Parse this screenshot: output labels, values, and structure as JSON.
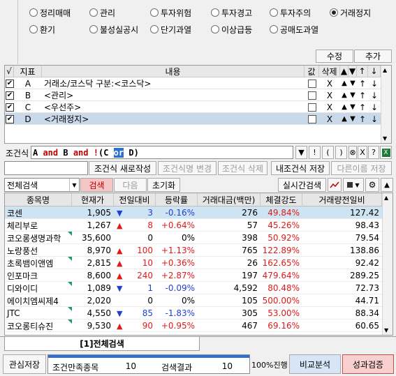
{
  "filters": {
    "row1": [
      {
        "label": "정리매매",
        "selected": false
      },
      {
        "label": "관리",
        "selected": false
      },
      {
        "label": "투자위험",
        "selected": false
      },
      {
        "label": "투자경고",
        "selected": false
      },
      {
        "label": "투자주의",
        "selected": false
      },
      {
        "label": "거래정지",
        "selected": true
      }
    ],
    "row2": [
      {
        "label": "환기",
        "selected": false
      },
      {
        "label": "불성실공시",
        "selected": false
      },
      {
        "label": "단기과열",
        "selected": false
      },
      {
        "label": "이상급등",
        "selected": false
      },
      {
        "label": "공매도과열",
        "selected": false
      }
    ]
  },
  "actions": {
    "modify": "수정",
    "add": "추가"
  },
  "condition_grid": {
    "headers": {
      "check": "√",
      "index": "지표",
      "content": "내용",
      "value": "값",
      "delete": "삭제"
    },
    "rows": [
      {
        "checked": true,
        "index": "A",
        "content": "거래소/코스닥 구분:<코스닥>",
        "delete": "X"
      },
      {
        "checked": true,
        "index": "B",
        "content": "<관리>",
        "delete": "X"
      },
      {
        "checked": true,
        "index": "C",
        "content": "<우선주>",
        "delete": "X"
      },
      {
        "checked": true,
        "index": "D",
        "content": "<거래정지>",
        "delete": "X",
        "selected": true
      }
    ]
  },
  "formula": {
    "label": "조건식",
    "tokens": [
      "A",
      " and ",
      "B",
      " and ",
      "!",
      "(",
      "C",
      " ",
      "or",
      " ",
      "D",
      ")"
    ],
    "op_tokens": [
      " and ",
      "!"
    ],
    "highlight_token": "or",
    "buttons": [
      "▼",
      "!",
      "(",
      ")",
      "⊗",
      "X",
      "?"
    ]
  },
  "cond_actions": {
    "input_value": "",
    "new": "조건식 새로작성",
    "rename": "조건식명 변경",
    "delete": "조건식 삭제",
    "save_mine": "내조건식 저장",
    "save_as": "다른이름 저장"
  },
  "search_bar": {
    "select_value": "전체검색",
    "search": "검색",
    "next": "다음",
    "reset": "초기화",
    "realtime": "실시간검색"
  },
  "results": {
    "headers": [
      "종목명",
      "현재가",
      "전일대비",
      "등락률",
      "거래대금(백만)",
      "체결강도",
      "거래량전일비"
    ],
    "rows": [
      {
        "name": "코센",
        "price": "1,905",
        "dir": "down",
        "change": "3",
        "rate": "-0.16%",
        "amount": "276",
        "strength": "49.84%",
        "vol_ratio": "127.42",
        "selected": true,
        "flag": false
      },
      {
        "name": "체리부로",
        "price": "1,267",
        "dir": "up",
        "change": "8",
        "rate": "+0.64%",
        "amount": "57",
        "strength": "45.26%",
        "vol_ratio": "98.43",
        "selected": false,
        "flag": false
      },
      {
        "name": "코오롱생명과학",
        "price": "35,600",
        "dir": "none",
        "change": "0",
        "rate": "0%",
        "amount": "398",
        "strength": "50.92%",
        "vol_ratio": "79.54",
        "selected": false,
        "flag": true
      },
      {
        "name": "노랑풍선",
        "price": "8,970",
        "dir": "up",
        "change": "100",
        "rate": "+1.13%",
        "amount": "765",
        "strength": "122.89%",
        "vol_ratio": "138.86",
        "selected": false,
        "flag": false
      },
      {
        "name": "초록뱀이앤엠",
        "price": "2,815",
        "dir": "up",
        "change": "10",
        "rate": "+0.36%",
        "amount": "26",
        "strength": "162.65%",
        "vol_ratio": "92.42",
        "selected": false,
        "flag": true
      },
      {
        "name": "인포마크",
        "price": "8,600",
        "dir": "up",
        "change": "240",
        "rate": "+2.87%",
        "amount": "197",
        "strength": "479.64%",
        "vol_ratio": "289.25",
        "selected": false,
        "flag": false
      },
      {
        "name": "디와이디",
        "price": "1,089",
        "dir": "down",
        "change": "1",
        "rate": "-0.09%",
        "amount": "4,592",
        "strength": "80.48%",
        "vol_ratio": "72.73",
        "selected": false,
        "flag": true
      },
      {
        "name": "에이치엠씨제4",
        "price": "2,020",
        "dir": "none",
        "change": "0",
        "rate": "0%",
        "amount": "105",
        "strength": "500.00%",
        "vol_ratio": "44.71",
        "selected": false,
        "flag": false
      },
      {
        "name": "JTC",
        "price": "4,550",
        "dir": "down",
        "change": "85",
        "rate": "-1.83%",
        "amount": "305",
        "strength": "53.00%",
        "vol_ratio": "88.34",
        "selected": false,
        "flag": true
      },
      {
        "name": "코오롱티슈진",
        "price": "9,530",
        "dir": "up",
        "change": "90",
        "rate": "+0.95%",
        "amount": "467",
        "strength": "69.16%",
        "vol_ratio": "60.65",
        "selected": false,
        "flag": true
      }
    ]
  },
  "tab": {
    "label": "[1]전체검색"
  },
  "status_bar": {
    "save_interest": "관심저장",
    "match_label": "조건만족종목",
    "match_count": "10",
    "result_label": "검색결과",
    "result_count": "10",
    "progress_text": "100%진행",
    "progress_fraction": 1.0,
    "compare": "비교분석",
    "verify": "성과검증"
  },
  "colors": {
    "up": "#e01a1a",
    "down": "#1f3fd6",
    "search_btn": "#f6c6c6",
    "compare_btn": "#d6e6f7",
    "verify_btn": "#f8d0d0"
  }
}
